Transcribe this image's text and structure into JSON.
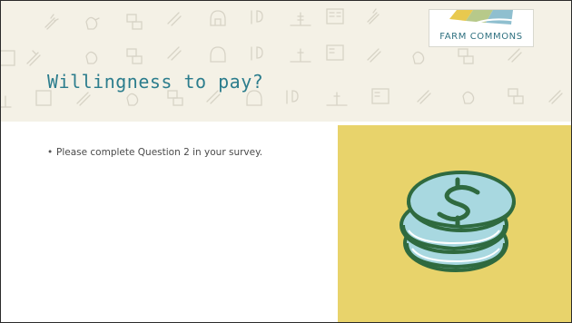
{
  "slide": {
    "title": "Willingness to pay?",
    "logo": {
      "text": "FARM COMMONS"
    },
    "bullets": [
      "Please complete Question 2 in your survey."
    ]
  },
  "colors": {
    "header_bg": "#f4f1e6",
    "title": "#2c7d8d",
    "panel": "#e8d36b",
    "coin_fill": "#a8d8e0",
    "coin_stroke": "#2f6a3f"
  },
  "icons": [
    "carrot-icon",
    "chicken-icon",
    "sprout-icon",
    "barn-icon",
    "utensils-icon",
    "field-icon",
    "document-icon",
    "dollar-coin-icon"
  ]
}
